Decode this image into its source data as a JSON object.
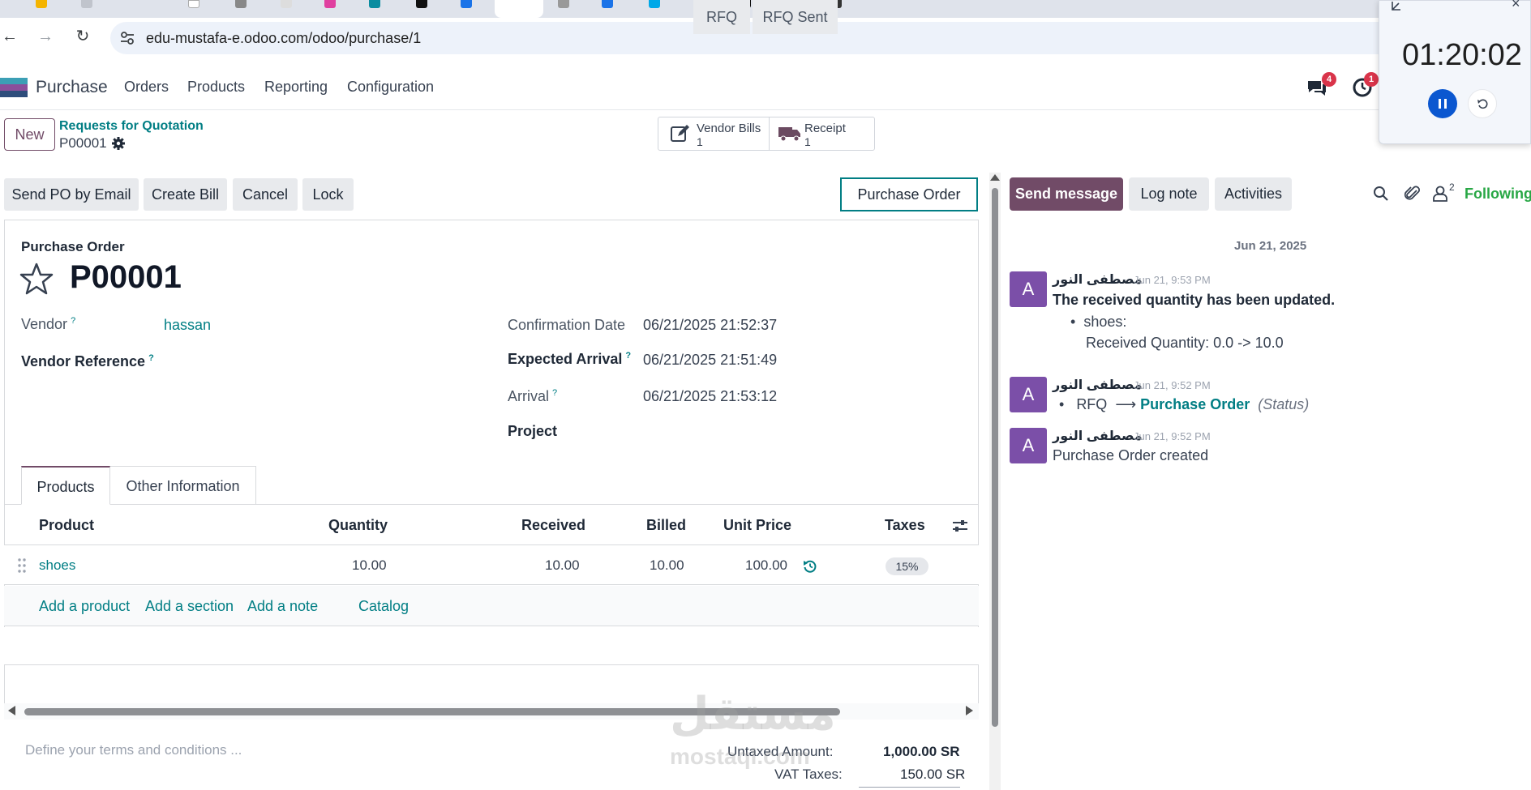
{
  "browser": {
    "url": "edu-mustafa-e.odoo.com/odoo/purchase/1"
  },
  "navbar": {
    "app_name": "Purchase",
    "menus": [
      "Orders",
      "Products",
      "Reporting",
      "Configuration"
    ],
    "messages_badge": "4",
    "activities_badge": "1"
  },
  "control_panel": {
    "new_label": "New",
    "breadcrumb_parent": "Requests for Quotation",
    "breadcrumb_current": "P00001",
    "smart_buttons": [
      {
        "label": "Vendor Bills",
        "count": "1",
        "icon": "edit-icon"
      },
      {
        "label": "Receipt",
        "count": "1",
        "icon": "truck-icon"
      }
    ]
  },
  "actions": [
    "Send PO by Email",
    "Create Bill",
    "Cancel",
    "Lock"
  ],
  "statusbar": {
    "stages": [
      "RFQ",
      "RFQ Sent",
      "Purchase Order"
    ],
    "current": "Purchase Order"
  },
  "form": {
    "doc_type": "Purchase Order",
    "name": "P00001",
    "vendor_label": "Vendor",
    "vendor_value": "hassan",
    "vendor_ref_label": "Vendor Reference",
    "confirmation_label": "Confirmation Date",
    "confirmation_value": "06/21/2025 21:52:37",
    "expected_label": "Expected Arrival",
    "expected_value": "06/21/2025 21:51:49",
    "arrival_label": "Arrival",
    "arrival_value": "06/21/2025 21:53:12",
    "project_label": "Project",
    "help_mark": "?"
  },
  "tabs": [
    "Products",
    "Other Information"
  ],
  "table": {
    "headers": [
      "Product",
      "Quantity",
      "Received",
      "Billed",
      "Unit Price",
      "Taxes"
    ],
    "rows": [
      {
        "product": "shoes",
        "quantity": "10.00",
        "received": "10.00",
        "billed": "10.00",
        "unit_price": "100.00",
        "taxes": "15%"
      }
    ],
    "add_links": [
      "Add a product",
      "Add a section",
      "Add a note",
      "Catalog"
    ]
  },
  "footer": {
    "terms_placeholder": "Define your terms and conditions ...",
    "untaxed_label": "Untaxed Amount:",
    "untaxed_value": "1,000.00 SR",
    "vat_label": "VAT Taxes:",
    "vat_value": "150.00 SR"
  },
  "chatter": {
    "send_message": "Send message",
    "log_note": "Log note",
    "activities": "Activities",
    "followers_count": "2",
    "following": "Following",
    "date_separator": "Jun 21, 2025",
    "messages": [
      {
        "avatar": "A",
        "author": "مصطفى النور",
        "date": "Jun 21, 9:53 PM",
        "title": "The received quantity has been updated.",
        "bullet": "shoes:",
        "detail": "Received Quantity: 0.0 -> 10.0"
      },
      {
        "avatar": "A",
        "author": "مصطفى النور",
        "date": "Jun 21, 9:52 PM",
        "from": "RFQ",
        "to": "Purchase Order",
        "field": "(Status)"
      },
      {
        "avatar": "A",
        "author": "مصطفى النور",
        "date": "Jun 21, 9:52 PM",
        "text": "Purchase Order created"
      }
    ]
  },
  "timer": {
    "time": "01:20:02"
  },
  "watermark": {
    "text": "مستقل",
    "sub": "mostaql.com"
  },
  "colors": {
    "brand": "#714b67",
    "link": "#017e84",
    "following": "#28a745"
  }
}
